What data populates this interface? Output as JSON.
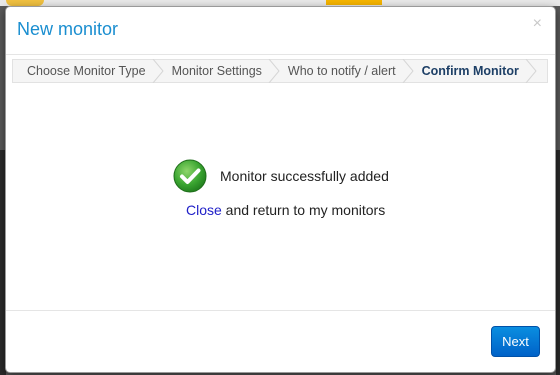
{
  "modal": {
    "title": "New monitor",
    "close_glyph": "×"
  },
  "steps": [
    {
      "label": "Choose Monitor Type",
      "active": false
    },
    {
      "label": "Monitor Settings",
      "active": false
    },
    {
      "label": "Who to notify / alert",
      "active": false
    },
    {
      "label": "Confirm Monitor",
      "active": true
    }
  ],
  "body": {
    "success_icon": "check-circle-icon",
    "success_message": "Monitor successfully added",
    "close_link": "Close",
    "return_text": " and return to my monitors"
  },
  "footer": {
    "next_label": "Next"
  },
  "colors": {
    "title": "#1a8ed0",
    "active_step": "#1d3f66",
    "link": "#2020c8",
    "button": "#0a7ad8",
    "success_green": "#3aa531"
  }
}
